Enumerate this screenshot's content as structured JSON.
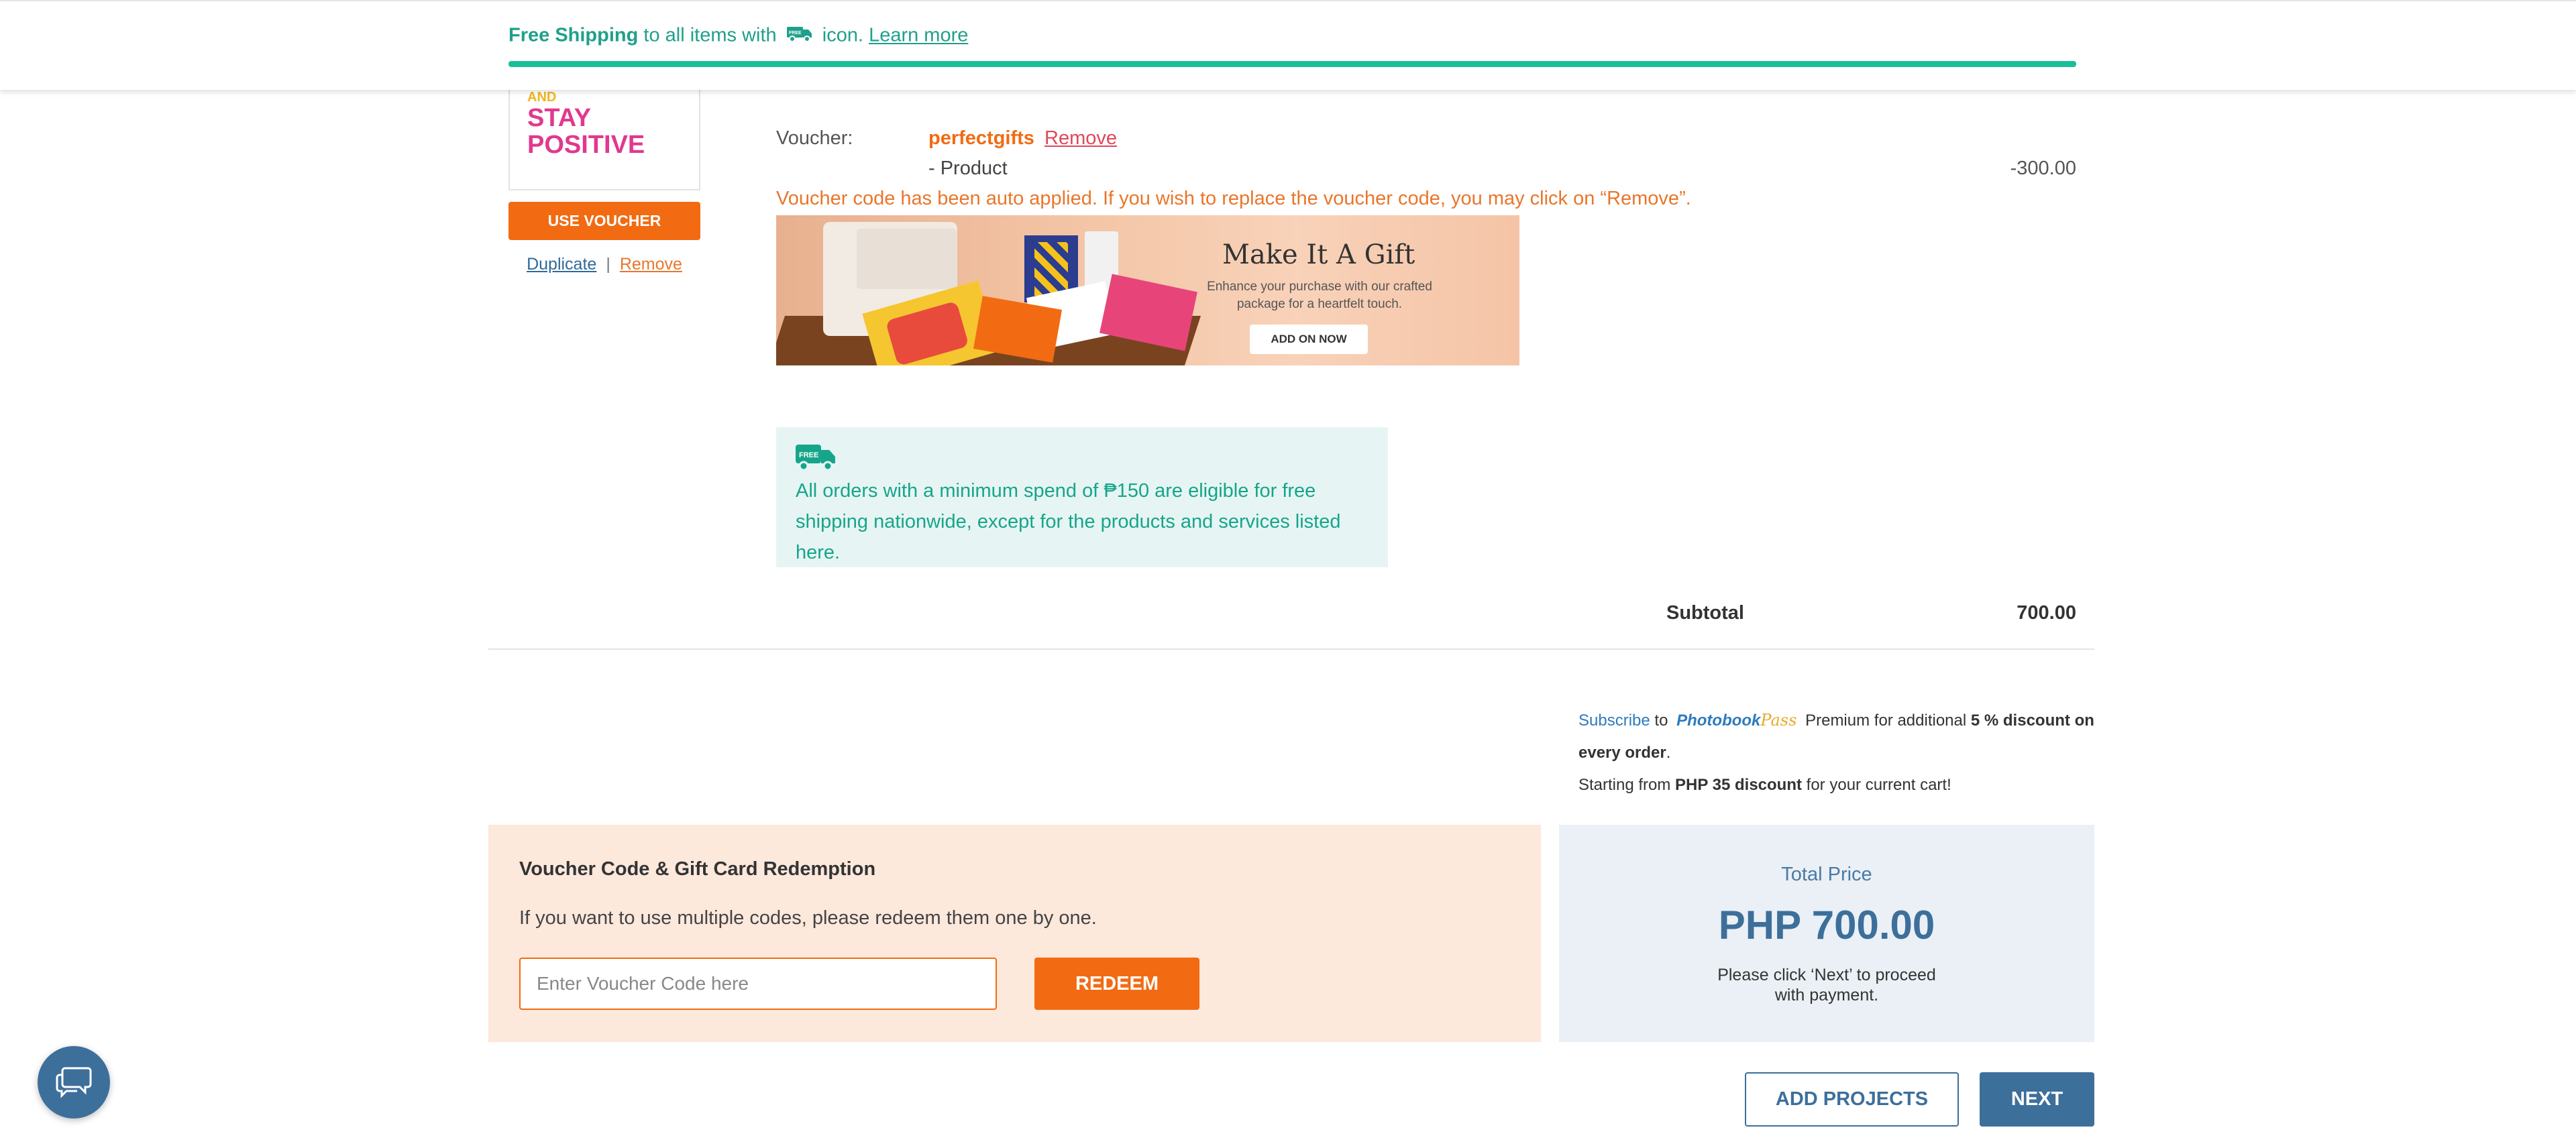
{
  "topbar": {
    "free_shipping": "Free Shipping",
    "message": " to all items with ",
    "icon_suffix": " icon. ",
    "learn_more": "Learn more",
    "truck_icon": "free-shipping-truck-icon",
    "accent_color": "#1bbd9b"
  },
  "product": {
    "thumb_line1": "AND",
    "thumb_line2": "STAY",
    "thumb_line3": "POSITIVE",
    "use_voucher": "USE VOUCHER",
    "duplicate": "Duplicate",
    "separator": "|",
    "remove": "Remove"
  },
  "voucher": {
    "label": "Voucher:",
    "code": "perfectgifts",
    "remove": "Remove",
    "product_line": "- Product",
    "amount": "-300.00",
    "note": "Voucher code has been auto applied. If you wish to replace the voucher code, you may click on “Remove”."
  },
  "gift_banner": {
    "title": "Make It A Gift",
    "subtitle": "Enhance your purchase with our crafted package for a heartfelt touch.",
    "button": "ADD ON NOW"
  },
  "shipping_info": {
    "badge": "FREE",
    "text": "All orders with a minimum spend of ₱150 are eligible for free shipping nationwide, except for the products and services listed here."
  },
  "subtotal": {
    "label": "Subtotal",
    "value": "700.00"
  },
  "promo": {
    "subscribe": "Subscribe",
    "to": " to ",
    "brand": "Photobook",
    "brand_script": "Pass",
    "premium": " Premium for additional ",
    "discount": "5 % discount on every order",
    "period": ".",
    "starting": "Starting from ",
    "amount": "PHP 35 discount",
    "suffix": " for your current cart!"
  },
  "redemption": {
    "title": "Voucher Code & Gift Card Redemption",
    "hint": "If you want to use multiple codes, please redeem them one by one.",
    "placeholder": "Enter Voucher Code here",
    "value": "",
    "button": "REDEEM"
  },
  "total": {
    "label": "Total Price",
    "price": "PHP 700.00",
    "note": "Please click ‘Next’ to proceed with payment."
  },
  "actions": {
    "add_projects": "ADD PROJECTS",
    "next": "NEXT"
  },
  "chat": {
    "icon": "chat-icon"
  }
}
